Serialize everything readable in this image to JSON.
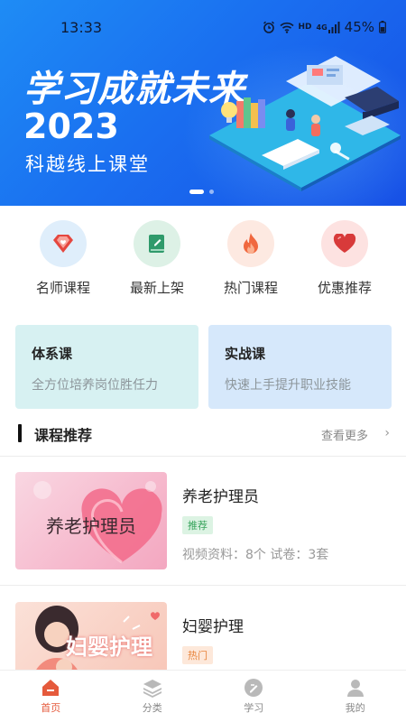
{
  "status_bar": {
    "time": "13:33",
    "network": "HD",
    "signal_label": "4G",
    "battery": "45%"
  },
  "banner": {
    "title": "学习成就未来",
    "year": "2023",
    "subtitle": "科越线上课堂",
    "active_slide": 1,
    "slide_count": 2
  },
  "categories": [
    {
      "label": "名师课程",
      "icon": "diamond-heart-icon",
      "color": "#e5473f",
      "bg": "#dfeefb"
    },
    {
      "label": "最新上架",
      "icon": "book-pen-icon",
      "color": "#2f9a6b",
      "bg": "#ddf1e6"
    },
    {
      "label": "热门课程",
      "icon": "flame-icon",
      "color": "#f0683f",
      "bg": "#fde9e1"
    },
    {
      "label": "优惠推荐",
      "icon": "heart-icon",
      "color": "#d83a3a",
      "bg": "#fde2e1"
    }
  ],
  "feature_cards": [
    {
      "title": "体系课",
      "subtitle": "全方位培养岗位胜任力"
    },
    {
      "title": "实战课",
      "subtitle": "快速上手提升职业技能"
    }
  ],
  "recommend": {
    "title": "课程推荐",
    "more": "查看更多",
    "arrow": "›",
    "courses": [
      {
        "thumb_text": "养老护理员",
        "name": "养老护理员",
        "tag": "推荐",
        "meta": "视频资料：8个   试卷：3套"
      },
      {
        "thumb_text": "妇婴护理",
        "name": "妇婴护理",
        "tag": "热门"
      }
    ]
  },
  "tabs": [
    {
      "label": "首页",
      "icon": "home-icon",
      "active": true
    },
    {
      "label": "分类",
      "icon": "layers-icon",
      "active": false
    },
    {
      "label": "学习",
      "icon": "study-icon",
      "active": false
    },
    {
      "label": "我的",
      "icon": "user-icon",
      "active": false
    }
  ],
  "colors": {
    "accent": "#e55a3c",
    "banner_blue": "#1a6ff0"
  }
}
